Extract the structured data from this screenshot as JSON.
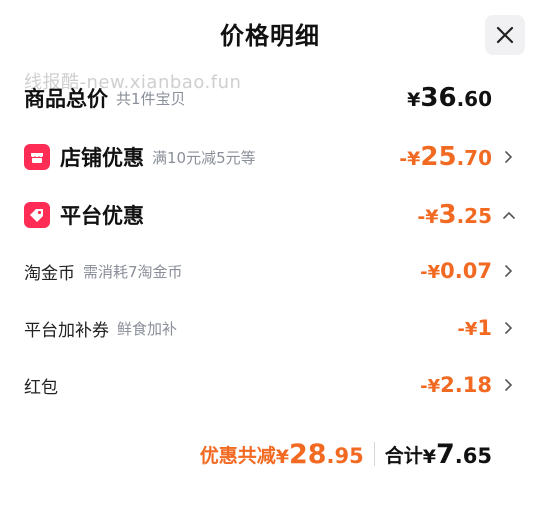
{
  "header": {
    "title": "价格明细"
  },
  "watermark": "线报酷-new.xianbao.fun",
  "subtotal": {
    "label": "商品总价",
    "sub": "共1件宝贝",
    "amount": {
      "prefix": "",
      "cur": "¥",
      "int": "36",
      "dec": ".60"
    }
  },
  "shop_discount": {
    "label": "店铺优惠",
    "sub": "满10元减5元等",
    "amount": {
      "prefix": "-",
      "cur": "¥",
      "int": "25",
      "dec": ".70"
    },
    "icon": "shop-icon",
    "chevron": "chevron-right-icon"
  },
  "platform_discount": {
    "label": "平台优惠",
    "amount": {
      "prefix": "-",
      "cur": "¥",
      "int": "3",
      "dec": ".25"
    },
    "icon": "tag-icon",
    "chevron": "chevron-up-icon"
  },
  "items": [
    {
      "label": "淘金币",
      "sub": "需消耗7淘金币",
      "amount": {
        "prefix": "-",
        "cur": "¥",
        "int": "0.07",
        "dec": ""
      }
    },
    {
      "label": "平台加补券",
      "sub": "鲜食加补",
      "amount": {
        "prefix": "-",
        "cur": "¥",
        "int": "1",
        "dec": ""
      }
    },
    {
      "label": "红包",
      "sub": "",
      "amount": {
        "prefix": "-",
        "cur": "¥",
        "int": "2.18",
        "dec": ""
      }
    }
  ],
  "footer": {
    "discount_label": "优惠共减",
    "discount_amount": {
      "cur": "¥",
      "int": "28",
      "dec": ".95"
    },
    "total_label": "合计",
    "total_amount": {
      "cur": "¥",
      "int": "7",
      "dec": ".65"
    }
  },
  "colors": {
    "accent": "#f26a22",
    "badge": "#ff2c55",
    "muted": "#8a8f99"
  }
}
